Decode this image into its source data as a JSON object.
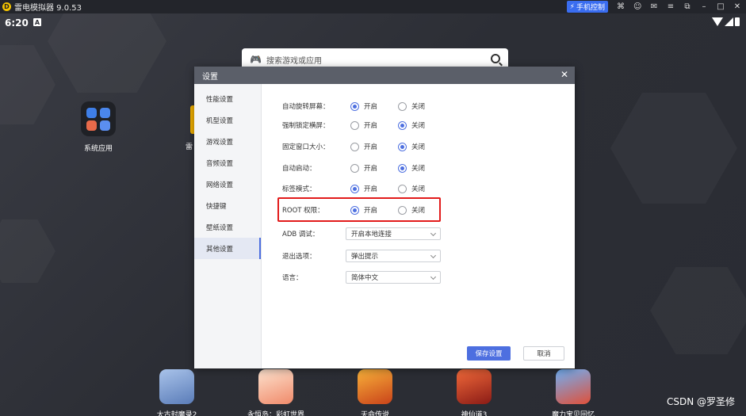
{
  "window": {
    "title": "雷电模拟器 9.0.53",
    "phone_control_label": "手机控制"
  },
  "statusbar": {
    "time": "6:20",
    "notification_badge": "A"
  },
  "search": {
    "placeholder": "搜索游戏或应用"
  },
  "desktop": {
    "system_apps_label": "系统应用",
    "partial_label": "雷"
  },
  "dock": [
    {
      "label": "太古封魔录2",
      "color": "#7ea3d6"
    },
    {
      "label": "永恒岛：彩虹世界",
      "color": "#f6b49a"
    },
    {
      "label": "天命传说",
      "color": "#e2761f"
    },
    {
      "label": "神仙道3",
      "color": "#c43a26"
    },
    {
      "label": "魔力宝贝回忆",
      "color": "#3f7ed8"
    }
  ],
  "watermark": "CSDN @罗圣修",
  "dialog": {
    "title": "设置",
    "sidebar": [
      "性能设置",
      "机型设置",
      "游戏设置",
      "音频设置",
      "网络设置",
      "快捷键",
      "壁纸设置",
      "其他设置"
    ],
    "active_index": 7,
    "on_label": "开启",
    "off_label": "关闭",
    "radio_rows": [
      {
        "label": "自动旋转屏幕：",
        "value": "on"
      },
      {
        "label": "强制锁定横屏：",
        "value": "off"
      },
      {
        "label": "固定窗口大小：",
        "value": "off"
      },
      {
        "label": "自动启动：",
        "value": "off"
      },
      {
        "label": "标签模式：",
        "value": "on"
      },
      {
        "label": "ROOT 权限：",
        "value": "on"
      }
    ],
    "select_rows": [
      {
        "label": "ADB 调试：",
        "value": "开启本地连接"
      },
      {
        "label": "退出选项：",
        "value": "弹出提示"
      },
      {
        "label": "语言：",
        "value": "简体中文"
      }
    ],
    "save_label": "保存设置",
    "cancel_label": "取消"
  },
  "colors": {
    "accent": "#4d6fe0",
    "highlight_box": "#e21b1b",
    "dialog_header": "#5b5f69"
  }
}
